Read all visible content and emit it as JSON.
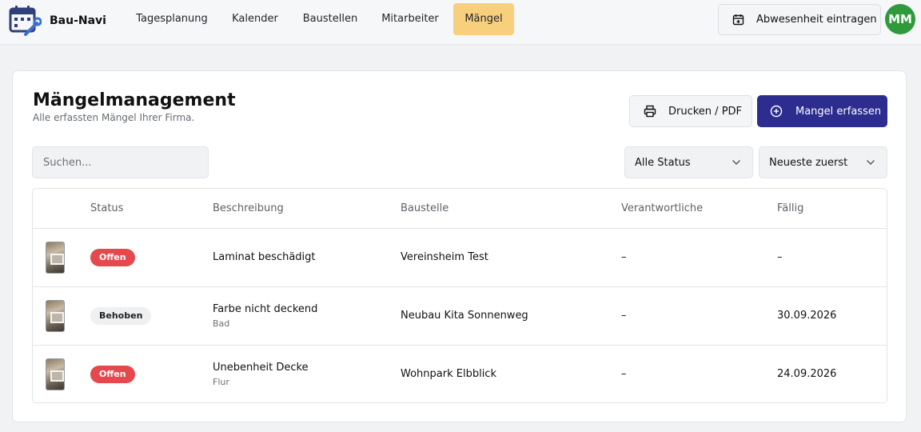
{
  "app": {
    "name": "Bau-Navi"
  },
  "nav": [
    {
      "label": "Tagesplanung",
      "active": false
    },
    {
      "label": "Kalender",
      "active": false
    },
    {
      "label": "Baustellen",
      "active": false
    },
    {
      "label": "Mitarbeiter",
      "active": false
    },
    {
      "label": "Mängel",
      "active": true
    }
  ],
  "header": {
    "absence_label": "Abwesenheit eintragen",
    "avatar_initials": "MM"
  },
  "page": {
    "title": "Mängelmanagement",
    "subtitle": "Alle erfassten Mängel Ihrer Firma.",
    "print_label": "Drucken / PDF",
    "new_label": "Mangel erfassen"
  },
  "filters": {
    "search_placeholder": "Suchen...",
    "status_value": "Alle Status",
    "sort_value": "Neueste zuerst"
  },
  "table": {
    "columns": [
      "Status",
      "Beschreibung",
      "Baustelle",
      "Verantwortliche",
      "Fällig"
    ],
    "rows": [
      {
        "status": "Offen",
        "description": "Laminat beschädigt",
        "location": "",
        "site": "Vereinsheim Test",
        "responsible": "–",
        "due": "–"
      },
      {
        "status": "Behoben",
        "description": "Farbe nicht deckend",
        "location": "Bad",
        "site": "Neubau Kita Sonnenweg",
        "responsible": "–",
        "due": "30.09.2026"
      },
      {
        "status": "Offen",
        "description": "Unebenheit Decke",
        "location": "Flur",
        "site": "Wohnpark Elbblick",
        "responsible": "–",
        "due": "24.09.2026"
      }
    ]
  },
  "colors": {
    "accent": "#2c2d8e",
    "active_nav": "#f8cf7d",
    "status_open": "#e5484d",
    "avatar": "#2e9a3c"
  }
}
